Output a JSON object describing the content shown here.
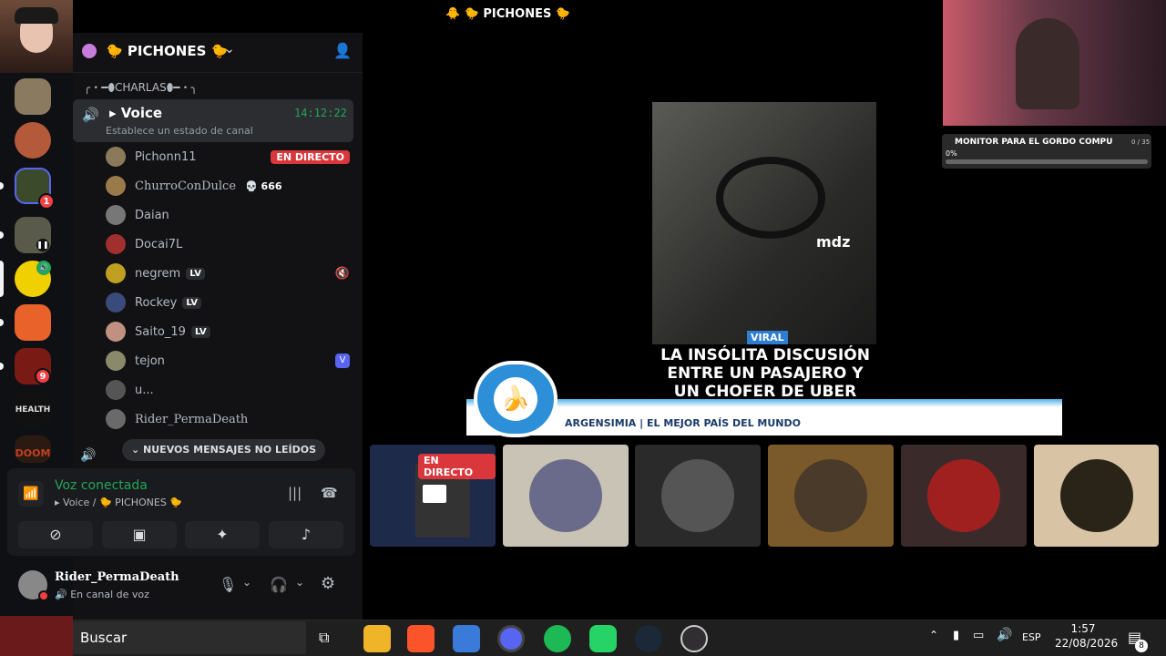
{
  "window": {
    "title": "🐥 🐤 PICHONES 🐤"
  },
  "server": {
    "name": "🐤 PICHONES 🐤"
  },
  "category": {
    "name": "╭・━⬮CHARLAS⬮━・╮"
  },
  "voice_channel": {
    "name": "▸ Voice",
    "timer": "14:12:22",
    "status": "Establece un estado de canal",
    "members": [
      {
        "name": "Pichonn11",
        "badge": "EN DIRECTO"
      },
      {
        "name": "ChurroConDulce",
        "badge": "💀 666"
      },
      {
        "name": "Daian",
        "badge": ""
      },
      {
        "name": "Docai7L",
        "badge": ""
      },
      {
        "name": "negrem",
        "badge": "LV"
      },
      {
        "name": "Rockey",
        "badge": "LV"
      },
      {
        "name": "Saito_19",
        "badge": "LV"
      },
      {
        "name": "tejon",
        "badge": ""
      },
      {
        "name": "u...",
        "badge": ""
      },
      {
        "name": "Rider_PermaDeath",
        "badge": ""
      }
    ]
  },
  "unread_banner": "NUEVOS MENSAJES NO LEÍDOS",
  "voice_panel": {
    "status": "Voz conectada",
    "location": "▸ Voice / 🐤 PICHONES 🐤"
  },
  "user": {
    "name": "Rider_PermaDeath",
    "status": "En canal de voz"
  },
  "rail_badges": {
    "a": "1",
    "b": "9",
    "health": "HEALTH",
    "doom": "DOOM"
  },
  "stream": {
    "tag": "VIRAL",
    "headline": [
      "LA INSÓLITA DISCUSIÓN",
      "ENTRE UN PASAJERO Y",
      "UN CHOFER DE UBER"
    ],
    "ticker": "ARGENSIMIA | EL MEJOR PAÍS DEL MUNDO",
    "watermark": "mdz"
  },
  "tiles": {
    "live_label": "EN DIRECTO"
  },
  "overlay": {
    "title": "MONITOR PARA EL GORDO COMPU",
    "count": "0 / 35",
    "percent": "0%",
    "progress": 0
  },
  "taskbar": {
    "search": "Buscar",
    "lang": "ESP",
    "time": "1:57",
    "date": "22/08/2026",
    "notif": "8"
  },
  "colors": {
    "accent": "#5865f2",
    "live": "#da373c",
    "green": "#23a55a"
  }
}
